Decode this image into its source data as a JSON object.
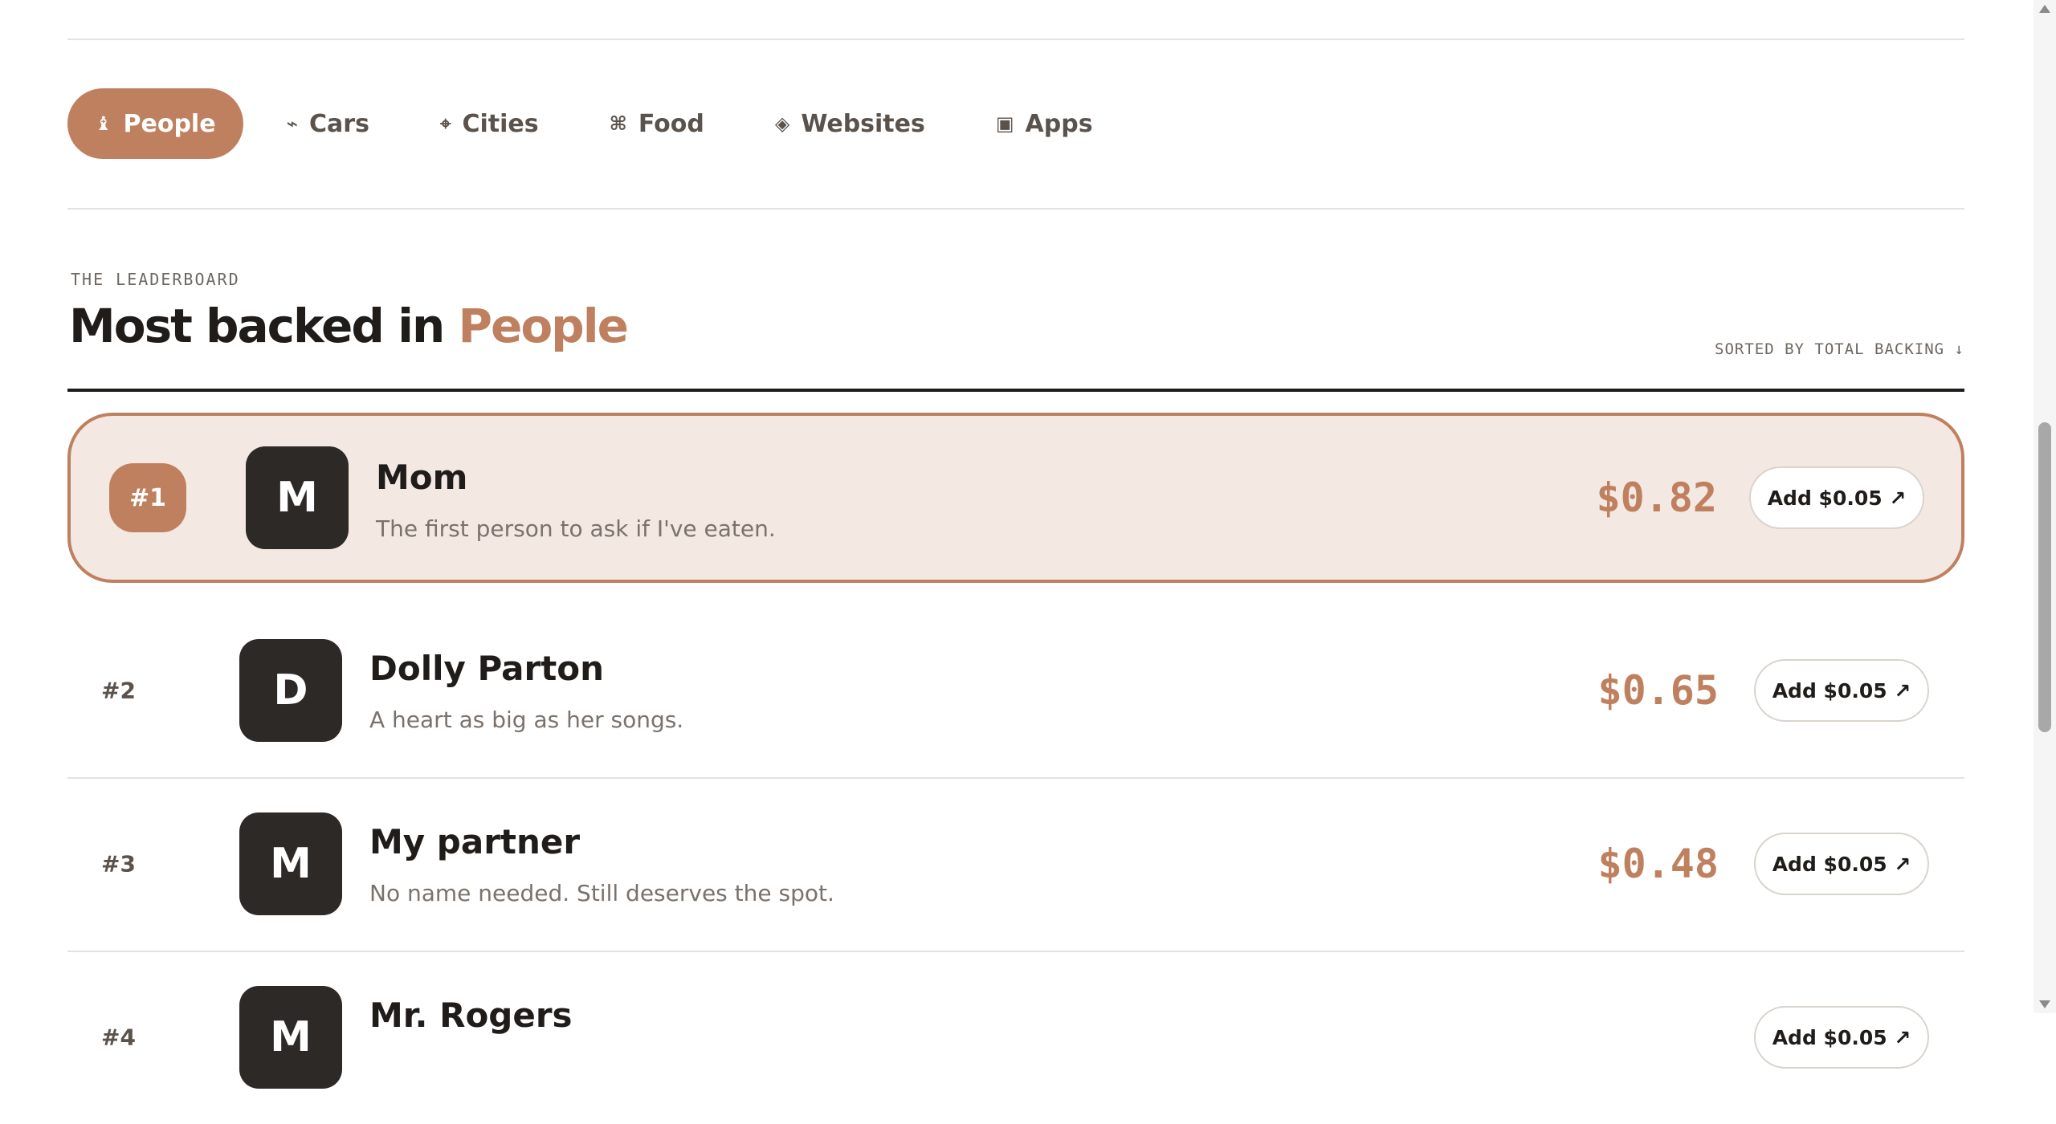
{
  "tabs": [
    {
      "icon": "♝",
      "label": "People",
      "active": true
    },
    {
      "icon": "⌁",
      "label": "Cars"
    },
    {
      "icon": "⌖",
      "label": "Cities"
    },
    {
      "icon": "⌘",
      "label": "Food"
    },
    {
      "icon": "◈",
      "label": "Websites"
    },
    {
      "icon": "▣",
      "label": "Apps"
    }
  ],
  "leaderboard": {
    "eyebrow": "THE LEADERBOARD",
    "title_prefix": "Most backed in",
    "title_category": "People",
    "sort_label": "SORTED BY TOTAL BACKING ↓"
  },
  "entries": [
    {
      "rank": "#1",
      "initial": "M",
      "name": "Mom",
      "description": "The first person to ask if I've eaten.",
      "amount": "$0.82",
      "cta": "Add $0.05 ↗"
    },
    {
      "rank": "#2",
      "initial": "D",
      "name": "Dolly Parton",
      "description": "A heart as big as her songs.",
      "amount": "$0.65",
      "cta": "Add $0.05 ↗"
    },
    {
      "rank": "#3",
      "initial": "M",
      "name": "My partner",
      "description": "No name needed. Still deserves the spot.",
      "amount": "$0.48",
      "cta": "Add $0.05 ↗"
    },
    {
      "rank": "#4",
      "initial": "M",
      "name": "Mr. Rogers",
      "description": "",
      "amount": "",
      "cta": "Add $0.05 ↗"
    }
  ],
  "colors": {
    "accent": "#bf805f",
    "featured_bg": "#f3e8e2",
    "avatar_bg": "#2d2927",
    "text": "#1f1c1a"
  }
}
